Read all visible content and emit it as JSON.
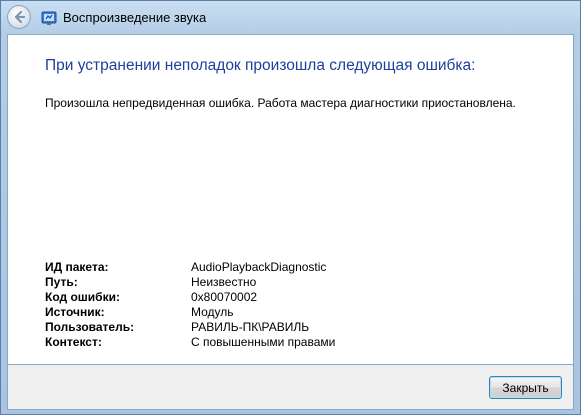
{
  "window": {
    "title": "Воспроизведение звука"
  },
  "content": {
    "heading": "При устранении неполадок произошла следующая ошибка:",
    "message": "Произошла непредвиденная ошибка. Работа мастера диагностики приостановлена.",
    "details": [
      {
        "label": "ИД пакета:",
        "value": "AudioPlaybackDiagnostic"
      },
      {
        "label": "Путь:",
        "value": "Неизвестно"
      },
      {
        "label": "Код ошибки:",
        "value": "0x80070002"
      },
      {
        "label": "Источник:",
        "value": "Модуль"
      },
      {
        "label": "Пользователь:",
        "value": "РАВИЛЬ-ПК\\РАВИЛЬ"
      },
      {
        "label": "Контекст:",
        "value": "С повышенными правами"
      }
    ]
  },
  "footer": {
    "close_label": "Закрыть"
  },
  "icons": {
    "back": "back-arrow-icon",
    "app": "troubleshooter-icon"
  },
  "colors": {
    "heading": "#1f3f9b",
    "frame": "#b4cde6"
  }
}
